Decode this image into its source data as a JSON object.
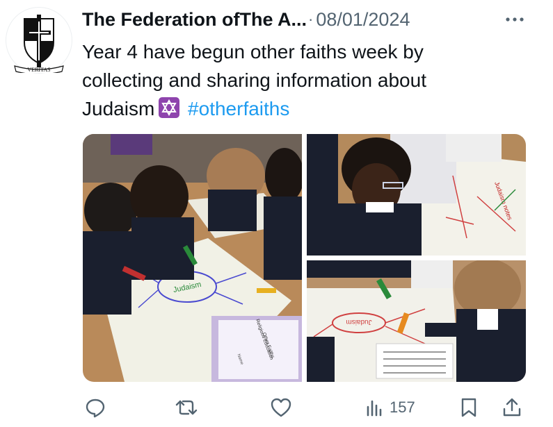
{
  "tweet": {
    "author": "The Federation ofThe A...",
    "separator": "·",
    "date": "08/01/2024",
    "text_line1": "Year 4 have begun other faiths week by",
    "text_line2": "collecting and sharing information about",
    "text_line3": "Judaism",
    "hashtag": "#otherfaiths",
    "avatar_motto": "VERITAS"
  },
  "media": {
    "sheet_word_main": "Judaism",
    "sheet_word_br": "Judaism",
    "sheet_word_tr": "Judaism notes",
    "book_title": "Religious Education",
    "book_subtitle": "Other Faiths",
    "book_name_label": "Name"
  },
  "actions": {
    "views_count": "157"
  },
  "colors": {
    "text": "#0f1419",
    "muted": "#536471",
    "link": "#1d9bf0"
  }
}
